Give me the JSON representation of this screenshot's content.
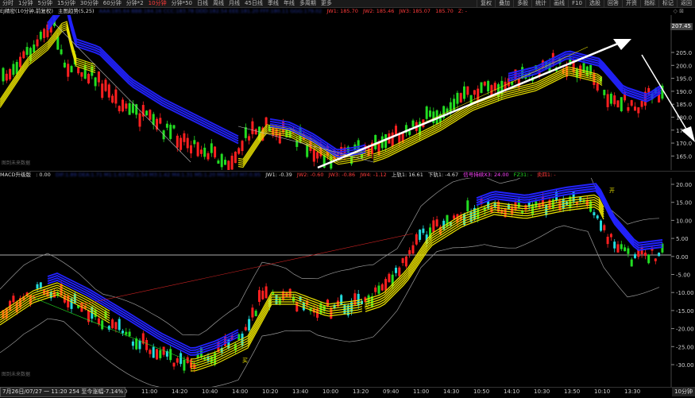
{
  "toolbar": {
    "periods": [
      "分时",
      "1分钟",
      "5分钟",
      "15分钟",
      "30分钟",
      "60分钟",
      "分钟*2",
      "10分钟",
      "分钟*50",
      "日线",
      "周线",
      "月线",
      "45日线",
      "季线",
      "年线",
      "多周期",
      "更多"
    ],
    "active_period": "10分钟",
    "right_buttons": [
      "复权",
      "叠加",
      "多股",
      "统计",
      "画线",
      "F10",
      "选股",
      "回答",
      "开资",
      "指标",
      "标记",
      "返回"
    ]
  },
  "main_info": {
    "title": "EJ精密(10分钟,前复权)",
    "indicator": "主图趋势(5,25)",
    "values_blur": "AAA:185.64 BBB:184.16 CCC:183.78 DDD:182.54 EEE:181.20 FFF:180.11 GGG:179.02",
    "jw1": "JW1: 185.70",
    "jw2": "JW2: 185.46",
    "jw3": "JW3: 185.07",
    "jw_extra": "185.70",
    "z": "Z: -"
  },
  "sub_info": {
    "title": "MACD升级版",
    "value": ": 0.00",
    "values_blur": "DIF:1.89 DEA:1.71 M1:1.63 M2:1.54 M3:1.42 M4:1.31 M5:1.20 M6:1.07 M7:0.95",
    "jw1": "JW1: -0.39",
    "jw2": "JW2: -0.60",
    "jw3": "JW3: -0.86",
    "jw4": "JW4: -1.12",
    "upper": "上轨1: 16.61",
    "lower": "下轨1: -4.67",
    "signal": "信号持续X3: 24.00",
    "fz": "FZ31: -",
    "buy": "卖四1: -"
  },
  "main_axis": {
    "last_price": "207.45",
    "ticks": [
      "205.0",
      "200.0",
      "195.0",
      "190.0",
      "185.0",
      "180.0",
      "175.0",
      "170.0",
      "165.0"
    ]
  },
  "sub_axis": {
    "ticks": [
      "20.00",
      "15.00",
      "10.00",
      "5.00",
      "0.00",
      "-5.00",
      "-10.00",
      "-15.00",
      "-20.00",
      "-25.00",
      "-30.00"
    ]
  },
  "time_axis": {
    "cursor": "7月26日/07/27 一 11:20 254 至今涨幅-7.14%",
    "labels": [
      "14:40",
      "11:00",
      "14:20",
      "10:40",
      "14:00",
      "10:20",
      "13:40",
      "10:00",
      "13:20",
      "09:40",
      "11:00",
      "14:30",
      "10:50",
      "14:10",
      "10:30",
      "13:50",
      "10:10",
      "13:30"
    ],
    "period": "10分钟"
  },
  "watermarks": {
    "main": "图到未来数据",
    "sub": "图到未来数据"
  },
  "buy_marks": [
    "买",
    "买",
    "开"
  ],
  "colors": {
    "up": "#ff2020",
    "down": "#22dd22",
    "ma_yellow": "#e8e000",
    "ma_blue": "#2222ff",
    "arrow": "#ffffff"
  }
}
